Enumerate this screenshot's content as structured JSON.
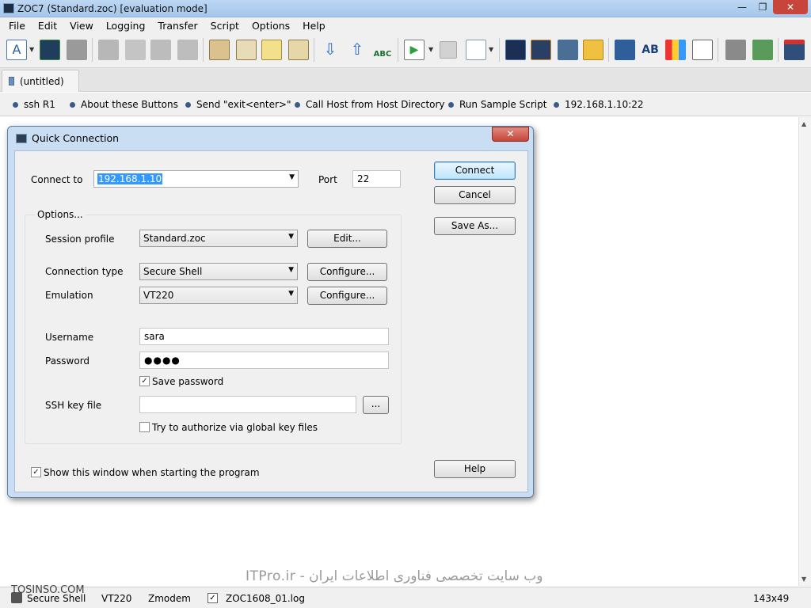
{
  "window": {
    "title": "ZOC7 (Standard.zoc) [evaluation mode]"
  },
  "menu": [
    "File",
    "Edit",
    "View",
    "Logging",
    "Transfer",
    "Script",
    "Options",
    "Help"
  ],
  "tabs": [
    {
      "label": "(untitled)"
    }
  ],
  "userbuttons": [
    "ssh R1",
    "About these Buttons",
    "Send \"exit<enter>\"",
    "Call Host from Host Directory",
    "Run Sample Script",
    "192.168.1.10:22"
  ],
  "dialog": {
    "title": "Quick Connection",
    "connect_to_label": "Connect to",
    "connect_to_value": "192.168.1.10",
    "port_label": "Port",
    "port_value": "22",
    "connect_button": "Connect",
    "cancel_button": "Cancel",
    "save_as_button": "Save As...",
    "help_button": "Help",
    "options_label": "Options...",
    "session_profile_label": "Session profile",
    "session_profile_value": "Standard.zoc",
    "edit_button": "Edit...",
    "connection_type_label": "Connection type",
    "connection_type_value": "Secure Shell",
    "configure_button": "Configure...",
    "emulation_label": "Emulation",
    "emulation_value": "VT220",
    "configure_button_2": "Configure...",
    "username_label": "Username",
    "username_value": "sara",
    "password_label": "Password",
    "password_value": "●●●●",
    "save_password_label": "Save password",
    "save_password_checked": true,
    "ssh_key_label": "SSH key file",
    "ssh_key_value": "",
    "browse_button": "...",
    "global_key_label": "Try to authorize via global key files",
    "global_key_checked": false,
    "show_window_label": "Show this window when starting the program",
    "show_window_checked": true
  },
  "watermark": "وب سایت تخصصی فناوری اطلاعات ایران - ITPro.ir",
  "tosinso": "TOSINSO.COM",
  "status": {
    "connection": "Secure Shell",
    "emulation": "VT220",
    "transfer": "Zmodem",
    "logfile": "ZOC1608_01.log",
    "size": "143x49"
  }
}
